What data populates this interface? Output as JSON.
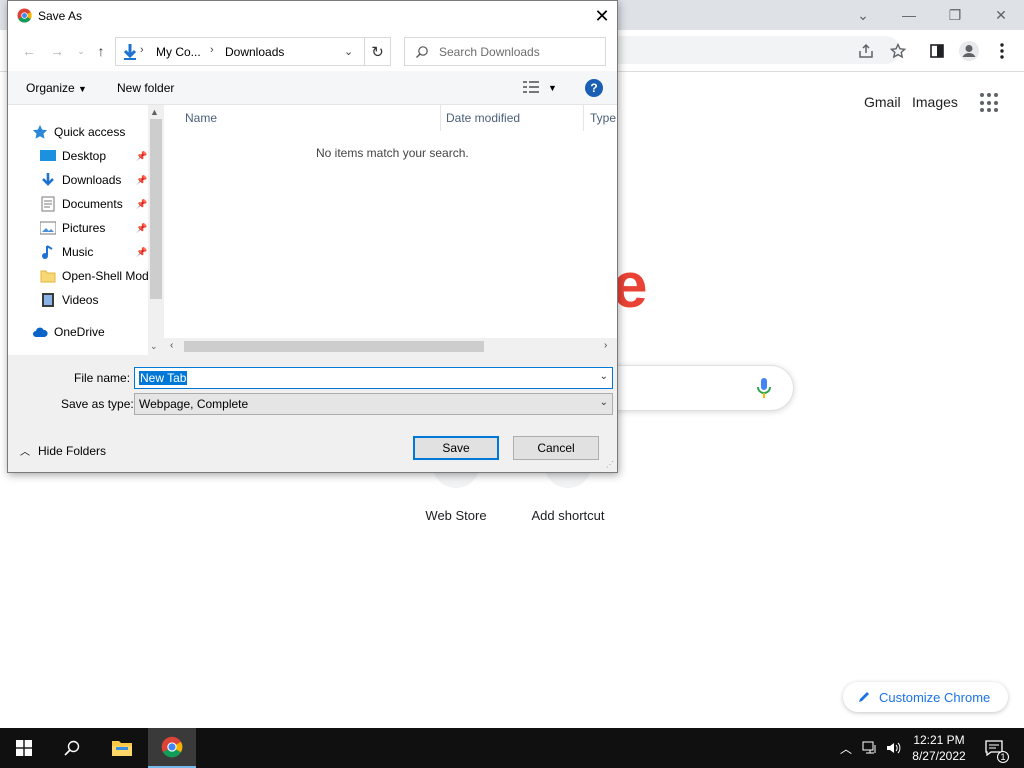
{
  "chrome": {
    "links": {
      "gmail": "Gmail",
      "images": "Images"
    },
    "shortcuts": [
      {
        "label": "Web Store"
      },
      {
        "label": "Add shortcut"
      }
    ],
    "customize_label": "Customize Chrome",
    "accent": "#1a73e8"
  },
  "dialog": {
    "title": "Save As",
    "address": {
      "segments": [
        "My Co...",
        "Downloads"
      ]
    },
    "search": {
      "placeholder": "Search Downloads"
    },
    "commands": {
      "organize": "Organize",
      "new_folder": "New folder",
      "help": "?"
    },
    "nav_items": [
      {
        "label": "Quick access",
        "icon": "star-icon"
      },
      {
        "label": "Desktop",
        "icon": "desktop-icon",
        "pinned": true
      },
      {
        "label": "Downloads",
        "icon": "download-icon",
        "pinned": true
      },
      {
        "label": "Documents",
        "icon": "document-icon",
        "pinned": true
      },
      {
        "label": "Pictures",
        "icon": "pictures-icon",
        "pinned": true
      },
      {
        "label": "Music",
        "icon": "music-icon",
        "pinned": true
      },
      {
        "label": "Open-Shell Mod",
        "icon": "folder-icon"
      },
      {
        "label": "Videos",
        "icon": "video-icon"
      },
      {
        "label": "OneDrive",
        "icon": "cloud-icon"
      }
    ],
    "columns": [
      "Name",
      "Date modified",
      "Type"
    ],
    "empty_message": "No items match your search.",
    "file_name": {
      "label": "File name:",
      "value": "New Tab"
    },
    "save_type": {
      "label": "Save as type:",
      "value": "Webpage, Complete"
    },
    "hide_folders": "Hide Folders",
    "buttons": {
      "save": "Save",
      "cancel": "Cancel"
    },
    "accent": "#0078d7"
  },
  "taskbar": {
    "clock": {
      "time": "12:21 PM",
      "date": "8/27/2022"
    },
    "notification_count": "1"
  }
}
